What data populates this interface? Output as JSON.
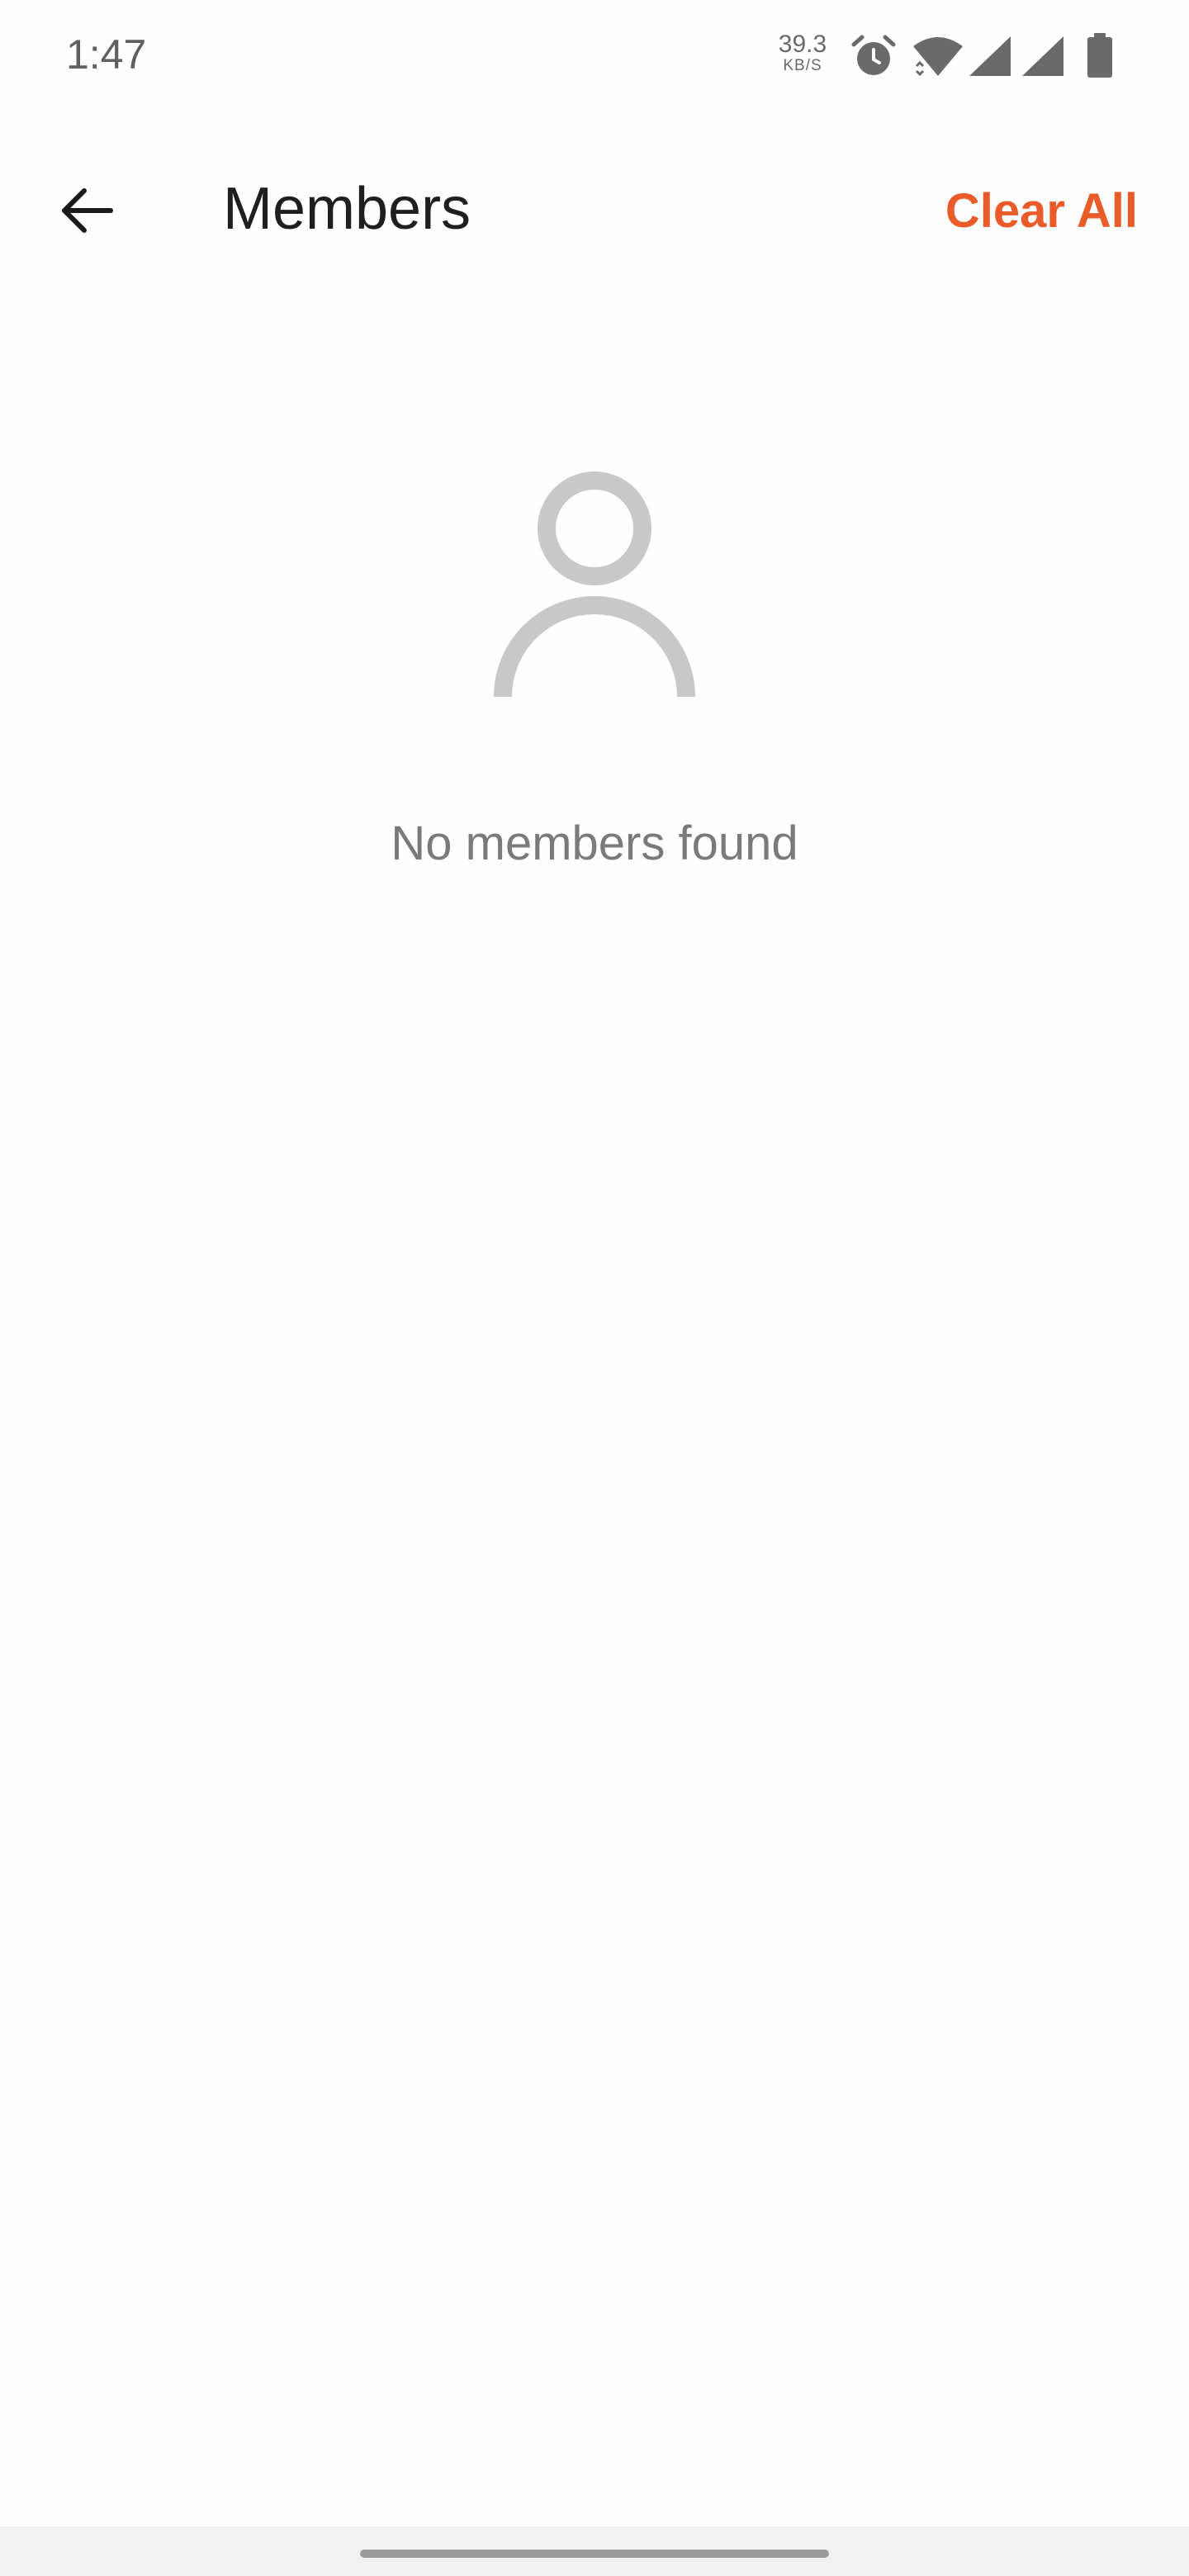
{
  "status_bar": {
    "time": "1:47",
    "net_speed_value": "39.3",
    "net_speed_unit": "KB/S",
    "icons": [
      "alarm-icon",
      "wifi-icon",
      "signal-icon",
      "signal-icon",
      "battery-icon"
    ]
  },
  "app_bar": {
    "back_icon": "arrow-left-icon",
    "title": "Members",
    "clear_all_label": "Clear All"
  },
  "empty_state": {
    "icon": "person-icon",
    "message": "No members found"
  },
  "colors": {
    "accent": "#ea5b2a",
    "title": "#1f1f1f",
    "muted_text": "#7a7a7a",
    "icon_gray": "#c8c8c8",
    "background": "#fefefe"
  }
}
